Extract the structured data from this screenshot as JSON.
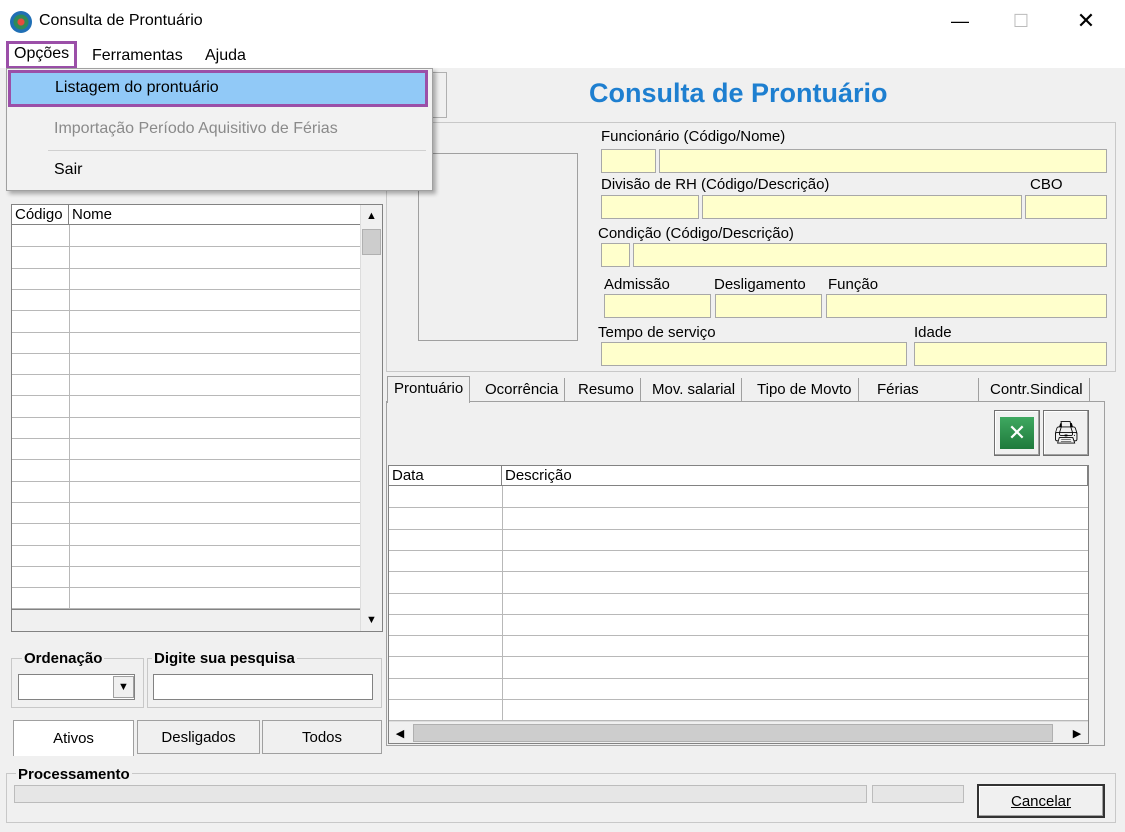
{
  "window": {
    "title": "Consulta de Prontuário"
  },
  "menubar": {
    "opcoes": "Opções",
    "ferramentas": "Ferramentas",
    "ajuda": "Ajuda"
  },
  "dropdown": {
    "items": [
      "Listagem do prontuário",
      "Importação Período Aquisitivo de Férias",
      "Sair"
    ]
  },
  "header": {
    "title": "Consulta de Prontuário"
  },
  "employee": {
    "funcionario_label": "Funcionário (Código/Nome)",
    "divisao_label": "Divisão de RH (Código/Descrição)",
    "cbo_label": "CBO",
    "condicao_label": "Condição (Código/Descrição)",
    "admissao_label": "Admissão",
    "desligamento_label": "Desligamento",
    "funcao_label": "Função",
    "tempo_label": "Tempo de serviço",
    "idade_label": "Idade"
  },
  "left_grid": {
    "columns": [
      "Código",
      "Nome"
    ]
  },
  "search": {
    "ordenacao_label": "Ordenação",
    "pesquisa_label": "Digite sua pesquisa"
  },
  "filter_tabs": [
    "Ativos",
    "Desligados",
    "Todos"
  ],
  "tabs": [
    "Prontuário",
    "Ocorrência",
    "Resumo",
    "Mov. salarial",
    "Tipo de Movto",
    "Férias",
    "Contr.Sindical"
  ],
  "right_grid": {
    "columns": [
      "Data",
      "Descrição"
    ]
  },
  "footer": {
    "processamento_label": "Processamento",
    "cancelar_label": "Cancelar"
  },
  "colors": {
    "accent_title": "#1e7fd0",
    "field_bg": "#ffffcc",
    "menu_highlight": "#91c9f7",
    "annotation_border": "#9b4fa8"
  }
}
